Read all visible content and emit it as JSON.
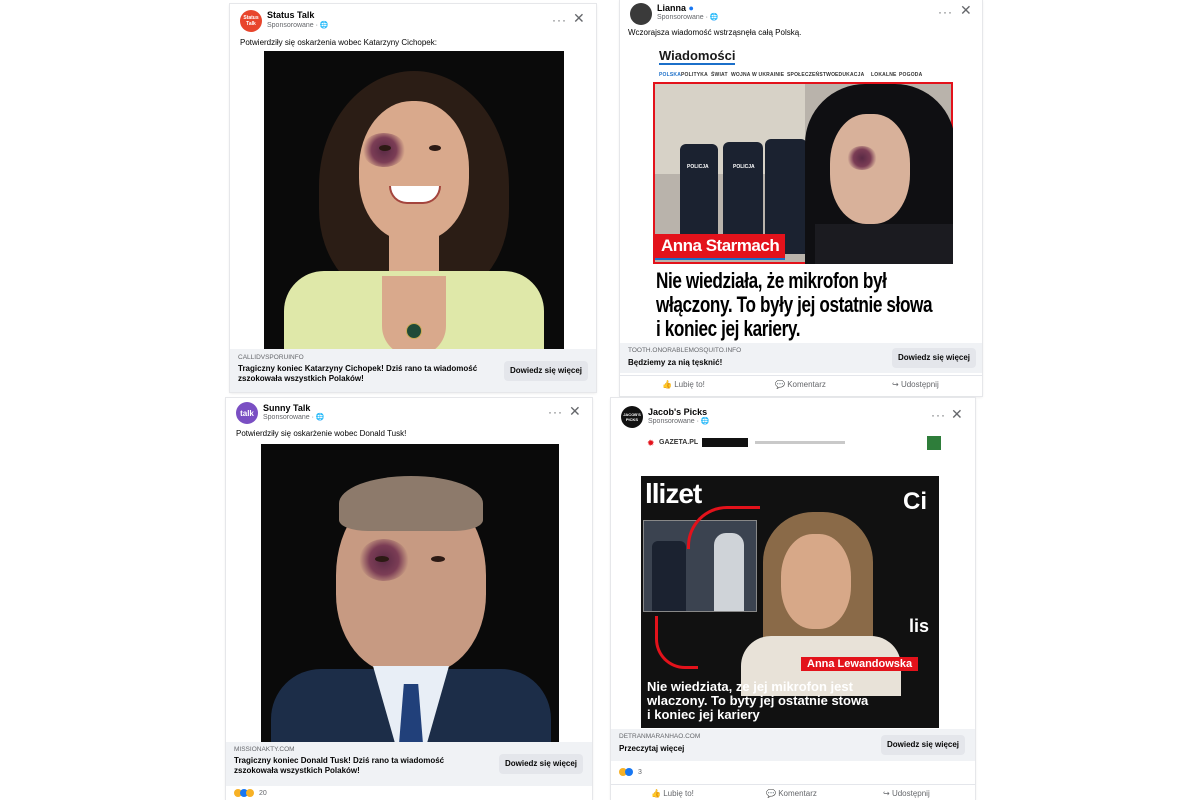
{
  "posts": [
    {
      "author": "Status Talk",
      "avatar_text": "Status Talk",
      "sponsored": "Sponsorowane · ",
      "text": "Potwierdziły się oskarżenia wobec Katarzyny Cichopek:",
      "domain": "CALLIDVSPORUINFO",
      "title": "Tragiczny koniec Katarzyny Cichopek! Dziś rano ta wiadomość zszokowała wszystkich Polaków!",
      "cta": "Dowiedz się więcej"
    },
    {
      "author": "Lianna",
      "sponsored": "Sponsorowane · ",
      "text": "Wczorajsza wiadomość wstrząsnęła całą Polską.",
      "news_logo": "Wiadomości",
      "news_nav": [
        "POLSKA",
        "POLITYKA",
        "ŚWIAT",
        "WOJNA W UKRAINIE",
        "SPOŁECZEŃSTWO",
        "EDUKACJA",
        "LOKALNE",
        "POGODA"
      ],
      "police_label": "POLICJA",
      "name_banner": "Anna Starmach",
      "headline": [
        "Nie wiedziała, że mikrofon był",
        "włączony. To były jej ostatnie słowa",
        "i koniec jej kariery."
      ],
      "domain": "TOOTH.ONORABLEMOSQUITO.INFO",
      "title": "Będziemy za nią tęsknić!",
      "cta": "Dowiedz się więcej",
      "actions": [
        "Lubię to!",
        "Komentarz",
        "Udostępnij"
      ]
    },
    {
      "author": "Sunny Talk",
      "avatar_text": "talk",
      "sponsored": "Sponsorowane · ",
      "text": "Potwierdziły się oskarżenie wobec Donald Tusk!",
      "domain": "MISSIONAKTY.COM",
      "title": "Tragiczny koniec Donald Tusk! Dziś rano ta wiadomość zszokowała wszystkich Polaków!",
      "cta": "Dowiedz się więcej",
      "reaction_count": "20"
    },
    {
      "author": "Jacob's Picks",
      "avatar_text": "JACOB'S PICKS",
      "sponsored": "Sponsorowane · ",
      "gazeta": "GAZETA.PL",
      "video_top_left": "llizet",
      "video_top_right": "Ci",
      "video_side": "lis",
      "name_banner": "Anna Lewandowska",
      "subtitle": [
        "Nie wiedziata, ze jej mikrofon jest",
        "wlaczony. To byty jej ostatnie stowa",
        "i koniec jej kariery"
      ],
      "domain": "DETRANMARANHAO.COM",
      "title": "Przeczytaj więcej",
      "cta": "Dowiedz się więcej",
      "reaction_count": "3",
      "actions": [
        "Lubię to!",
        "Komentarz",
        "Udostępnij"
      ]
    }
  ],
  "icons": {
    "menu": "···",
    "close": "✕"
  },
  "colors": {
    "fb_gray": "#f0f2f5",
    "news_red": "#e3121b",
    "jacket": "#dfe8a9"
  }
}
